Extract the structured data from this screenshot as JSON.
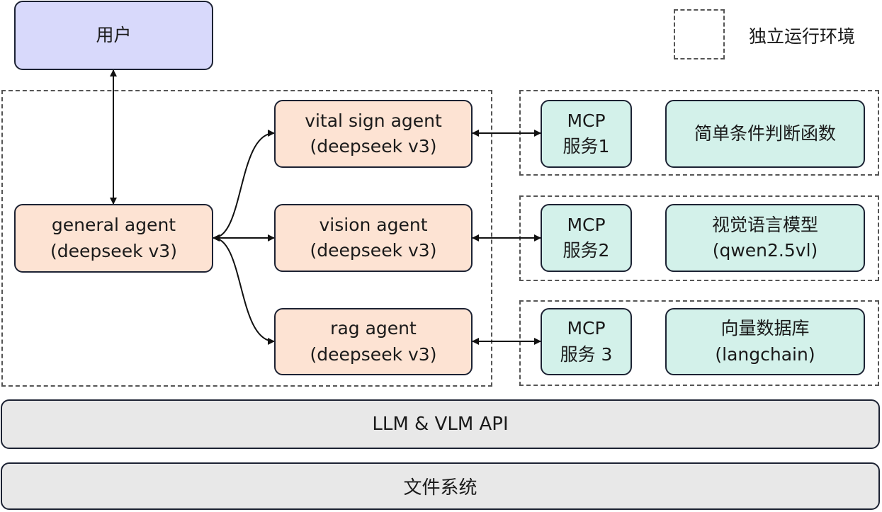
{
  "user": {
    "label": "用户"
  },
  "legend": {
    "label": "独立运行环境"
  },
  "general_agent": {
    "line1": "general agent",
    "line2": "(deepseek v3)"
  },
  "agents": [
    {
      "line1": "vital sign agent",
      "line2": "(deepseek v3)"
    },
    {
      "line1": "vision agent",
      "line2": "(deepseek v3)"
    },
    {
      "line1": "rag agent",
      "line2": "(deepseek v3)"
    }
  ],
  "mcp": [
    {
      "line1": "MCP",
      "line2": "服务1"
    },
    {
      "line1": "MCP",
      "line2": "服务2"
    },
    {
      "line1": "MCP",
      "line2": "服务 3"
    }
  ],
  "tools": [
    {
      "line1": "简单条件判断函数",
      "line2": ""
    },
    {
      "line1": "视觉语言模型",
      "line2": "(qwen2.5vl)"
    },
    {
      "line1": "向量数据库",
      "line2": "(langchain)"
    }
  ],
  "layers": {
    "api": "LLM & VLM API",
    "fs": "文件系统"
  },
  "colors": {
    "user": "#d8d9fb",
    "agent": "#fde3d3",
    "service": "#d3f1ea",
    "layer": "#e8e8e8",
    "line": "#1c2233"
  }
}
